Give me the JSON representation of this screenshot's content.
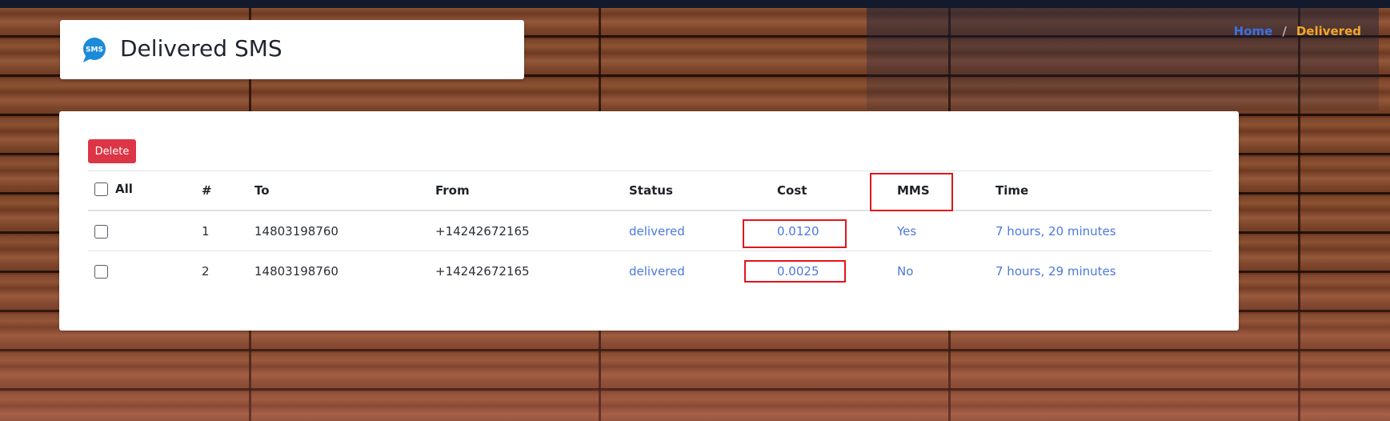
{
  "breadcrumb": {
    "home": "Home",
    "separator": "/",
    "current": "Delivered"
  },
  "header": {
    "title": "Delivered SMS",
    "icon": "sms-chat-bubble-icon",
    "icon_text": "SMS"
  },
  "toolbar": {
    "delete_label": "Delete"
  },
  "table": {
    "columns": {
      "select_all": "All",
      "num": "#",
      "to": "To",
      "from": "From",
      "status": "Status",
      "cost": "Cost",
      "mms": "MMS",
      "time": "Time"
    },
    "rows": [
      {
        "num": "1",
        "to": "14803198760",
        "from": "+14242672165",
        "status": "delivered",
        "cost": "0.0120",
        "mms": "Yes",
        "time": "7 hours, 20 minutes"
      },
      {
        "num": "2",
        "to": "14803198760",
        "from": "+14242672165",
        "status": "delivered",
        "cost": "0.0025",
        "mms": "No",
        "time": "7 hours, 29 minutes"
      }
    ]
  },
  "colors": {
    "accent_link": "#4c78dd",
    "breadcrumb_home": "#3d6fe0",
    "breadcrumb_current": "#f2a72d",
    "delete_button": "#dc3545",
    "highlight_box": "#e3141b",
    "icon_blue": "#1a8ad9"
  }
}
